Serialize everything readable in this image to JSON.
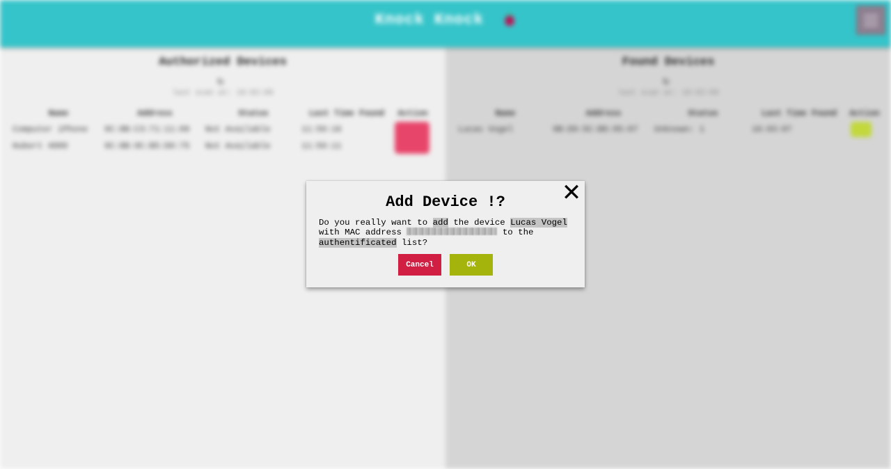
{
  "header": {
    "title": "Knock Knock",
    "logo_icon": "raspberry-pi-icon",
    "menu_icon": "hamburger-menu-icon",
    "accent_color": "#35c4c9"
  },
  "left_panel": {
    "title": "Authorized Devices",
    "refresh_icon": "↻",
    "last_scan": "last scan at: 16:02:09",
    "columns": [
      "Name",
      "Address",
      "Status",
      "Last Time Found",
      "Action"
    ],
    "rows": [
      {
        "name": "Computer iPhone",
        "address": "9C:8B:C3:71:11:09",
        "status": "Not Available",
        "last_found": "11:59:16"
      },
      {
        "name": "Hubert 4000",
        "address": "9C:8B:9C:B5:D0:75",
        "status": "Not Available",
        "last_found": "11:59:11"
      }
    ],
    "action_color": "#e8456a"
  },
  "right_panel": {
    "title": "Found Devices",
    "refresh_icon": "↻",
    "last_scan": "last scan at: 16:02:09",
    "columns": [
      "Name",
      "Address",
      "Status",
      "Last Time Found",
      "Action"
    ],
    "rows": [
      {
        "name": "Lucas Vogel",
        "address": "9B:D9:5C:B8:95:07",
        "status": "Unknown: 1",
        "last_found": "16:03:07"
      }
    ],
    "action_color": "#c2d83c"
  },
  "modal": {
    "title": "Add Device !?",
    "close_icon": "✕",
    "text_prefix": "Do you really want to ",
    "action_word": "add",
    "text_middle": " the device ",
    "device_name": "Lucas Vogel",
    "text_mac_label": " with MAC address ",
    "text_after_mac": " to the ",
    "list_name": "authentificated",
    "text_suffix": " list?",
    "cancel_label": "Cancel",
    "ok_label": "OK",
    "cancel_color": "#d11f44",
    "ok_color": "#a4b40d"
  }
}
